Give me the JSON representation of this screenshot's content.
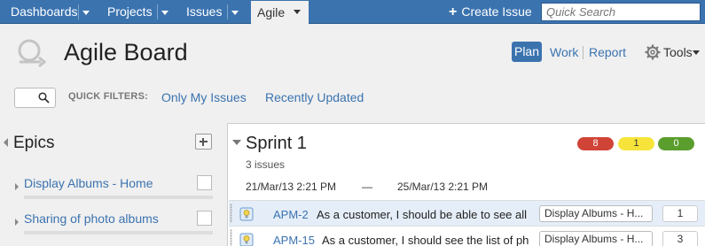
{
  "nav": {
    "items": [
      {
        "label": "Dashboards"
      },
      {
        "label": "Projects"
      },
      {
        "label": "Issues"
      }
    ],
    "active": {
      "label": "Agile"
    },
    "create_label": "Create Issue",
    "search_placeholder": "Quick Search"
  },
  "header": {
    "title": "Agile Board",
    "modes": {
      "plan": "Plan",
      "work": "Work",
      "report": "Report"
    },
    "active_mode": "Plan",
    "tools_label": "Tools"
  },
  "filters": {
    "label": "QUICK FILTERS:",
    "items": [
      "Only My Issues",
      "Recently Updated"
    ]
  },
  "epics": {
    "title": "Epics",
    "items": [
      {
        "name": "Display Albums - Home"
      },
      {
        "name": "Sharing of photo albums"
      }
    ]
  },
  "sprint": {
    "title": "Sprint 1",
    "issue_count": "3 issues",
    "start": "21/Mar/13 2:21 PM",
    "dash": "—",
    "end": "25/Mar/13 2:21 PM",
    "status_counts": {
      "todo": "8",
      "in_progress": "1",
      "done": "0"
    },
    "issues": [
      {
        "key": "APM-2",
        "summary": "As a customer, I should be able to see all",
        "epic": "Display Albums - H...",
        "points": "1",
        "type_icon": "story-icon"
      },
      {
        "key": "APM-15",
        "summary": "As a customer, I should see the list of ph",
        "epic": "Display Albums - H...",
        "points": "3",
        "type_icon": "story-icon"
      }
    ]
  },
  "colors": {
    "brand": "#3b73af",
    "todo": "#d04437",
    "in_progress": "#f6e43b",
    "done": "#5b9e2e"
  }
}
